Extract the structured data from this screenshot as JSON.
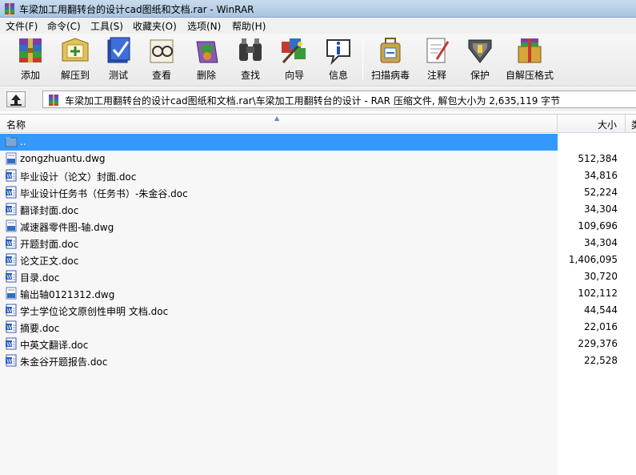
{
  "window": {
    "title": "车梁加工用翻转台的设计cad图纸和文档.rar - WinRAR"
  },
  "menu": [
    "文件(F)",
    "命令(C)",
    "工具(S)",
    "收藏夹(O)",
    "选项(N)",
    "帮助(H)"
  ],
  "toolbar": [
    {
      "label": "添加",
      "icon": "add-archive-icon"
    },
    {
      "label": "解压到",
      "icon": "extract-to-icon"
    },
    {
      "label": "测试",
      "icon": "test-icon"
    },
    {
      "label": "查看",
      "icon": "view-icon"
    },
    {
      "label": "删除",
      "icon": "delete-icon"
    },
    {
      "label": "查找",
      "icon": "find-icon"
    },
    {
      "label": "向导",
      "icon": "wizard-icon"
    },
    {
      "label": "信息",
      "icon": "info-icon"
    },
    {
      "label": "扫描病毒",
      "icon": "virus-scan-icon"
    },
    {
      "label": "注释",
      "icon": "comment-icon"
    },
    {
      "label": "保护",
      "icon": "protect-icon"
    },
    {
      "label": "自解压格式",
      "icon": "sfx-icon"
    }
  ],
  "address": {
    "text": "车梁加工用翻转台的设计cad图纸和文档.rar\\车梁加工用翻转台的设计 - RAR 压缩文件, 解包大小为 2,635,119 字节"
  },
  "columns": {
    "name": "名称",
    "size": "大小",
    "type": "类"
  },
  "files": [
    {
      "name": "..",
      "size": "",
      "icon": "parent-folder-icon",
      "selected": true
    },
    {
      "name": "zongzhuantu.dwg",
      "size": "512,384",
      "icon": "dwg-file-icon"
    },
    {
      "name": "毕业设计（论文）封面.doc",
      "size": "34,816",
      "icon": "word-doc-icon"
    },
    {
      "name": "毕业设计任务书（任务书）-朱金谷.doc",
      "size": "52,224",
      "icon": "word-doc-icon"
    },
    {
      "name": "翻译封面.doc",
      "size": "34,304",
      "icon": "word-doc-icon"
    },
    {
      "name": "减速器零件图-轴.dwg",
      "size": "109,696",
      "icon": "dwg-file-icon"
    },
    {
      "name": "开题封面.doc",
      "size": "34,304",
      "icon": "word-doc-icon"
    },
    {
      "name": "论文正文.doc",
      "size": "1,406,095",
      "icon": "word-doc-icon"
    },
    {
      "name": "目录.doc",
      "size": "30,720",
      "icon": "word-doc-icon"
    },
    {
      "name": "输出轴0121312.dwg",
      "size": "102,112",
      "icon": "dwg-file-icon"
    },
    {
      "name": "学士学位论文原创性申明 文档.doc",
      "size": "44,544",
      "icon": "word-doc-icon"
    },
    {
      "name": "摘要.doc",
      "size": "22,016",
      "icon": "word-doc-icon"
    },
    {
      "name": "中英文翻译.doc",
      "size": "229,376",
      "icon": "word-doc-icon"
    },
    {
      "name": "朱金谷开题报告.doc",
      "size": "22,528",
      "icon": "word-doc-icon"
    }
  ],
  "colors": {
    "selection": "#3399ff",
    "titlebar": "#b9d1ea"
  }
}
